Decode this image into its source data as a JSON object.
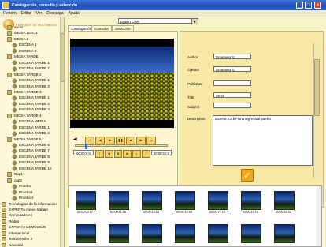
{
  "window": {
    "title": "Catalogación, consulta y selección",
    "buttons": [
      "_",
      "□",
      "×"
    ]
  },
  "menubar": [
    "Fichero",
    "Editar",
    "Ver",
    "Descarga",
    "Ayuda"
  ],
  "sidebar": {
    "logo_text": "SERVIDOR DE MULTIMEDIA",
    "items": [
      {
        "label": "audio",
        "level": 1
      },
      {
        "label": "MEDIA DOC 1",
        "level": 1
      },
      {
        "label": "MEDIA 2",
        "level": 1
      },
      {
        "label": "ESCENA 3",
        "level": 2
      },
      {
        "label": "ESCENA 3",
        "level": 2
      },
      {
        "label": "MEDIA TARDE",
        "level": 1
      },
      {
        "label": "ESCENA TARDE 1",
        "level": 2
      },
      {
        "label": "ESCENA TARDE 1",
        "level": 2
      },
      {
        "label": "MEDIA TARDE 2",
        "level": 1
      },
      {
        "label": "ESCENA TARDE 1",
        "level": 2
      },
      {
        "label": "ESCENA TARDE 2",
        "level": 2
      },
      {
        "label": "MEDIA TARDE 3",
        "level": 1
      },
      {
        "label": "ESCENA TARDE 1",
        "level": 2
      },
      {
        "label": "ESCENA TARDE 2",
        "level": 2
      },
      {
        "label": "ESCENA TARDE 4",
        "level": 2
      },
      {
        "label": "MEDIA TARDE 4",
        "level": 1
      },
      {
        "label": "ESCENA MEDIA",
        "level": 2
      },
      {
        "label": "ESCENA TARDE 1",
        "level": 2
      },
      {
        "label": "ESCENA TARDE 4",
        "level": 2
      },
      {
        "label": "MEDIA TARDE 5",
        "level": 1
      },
      {
        "label": "ESCENA TARDE 6",
        "level": 2
      },
      {
        "label": "ESCENA TARDE 7",
        "level": 2
      },
      {
        "label": "ESCENA TARDE 8",
        "level": 2
      },
      {
        "label": "ESCENA TARDE 9",
        "level": 2
      },
      {
        "label": "ESCENA TARDE 10",
        "level": 2
      },
      {
        "label": "Cap1",
        "level": 1
      },
      {
        "label": "cap2",
        "level": 1
      },
      {
        "label": "Prueba",
        "level": 2
      },
      {
        "label": "Prueba2",
        "level": 2
      },
      {
        "label": "Prueba 4",
        "level": 2
      },
      {
        "label": "Tecnologías de la información",
        "level": 0
      },
      {
        "label": "EXPERTA nuevo trabajo",
        "level": 0
      },
      {
        "label": "Computadores",
        "level": 0
      },
      {
        "label": "Redes",
        "level": 0
      },
      {
        "label": "EXPERTA DEMOSIÓN",
        "level": 0
      },
      {
        "label": "Internacional",
        "level": 0
      },
      {
        "label": "Todo trestibe 2",
        "level": 0
      },
      {
        "label": "Nacional",
        "level": 0
      }
    ]
  },
  "tabs": [
    "Catalogación",
    "Consulta",
    "Selección"
  ],
  "player": {
    "time_start": "00:00:0 0",
    "time_end": "00:00:10.0",
    "seek_position": 0.1
  },
  "metadata": {
    "type_selected": "Dublin Core",
    "fields": [
      {
        "label": "Author",
        "value": "Dreamworkz"
      },
      {
        "label": "Creator",
        "value": "Dreamworkz"
      },
      {
        "label": "Publisher",
        "value": ""
      },
      {
        "label": "Title",
        "value": "Shrek"
      },
      {
        "label": "Subject",
        "value": ""
      }
    ],
    "description_label": "Description",
    "description_value": "Escena 8.2 b Fiona regresa al pueblo",
    "ok_icon": "check-icon"
  },
  "thumbnails": {
    "row1_times": [
      "00:00:00.17",
      "00:00:11.96",
      "00:00:13.13",
      "00:00:15.05",
      "00:00:17.10",
      "00:00:19.10",
      "00:00:22.01"
    ],
    "row2_count": 7
  },
  "colors": {
    "title_bar": "#1d4fb8",
    "background": "#f8f2c8",
    "accent": "#f2a818"
  }
}
